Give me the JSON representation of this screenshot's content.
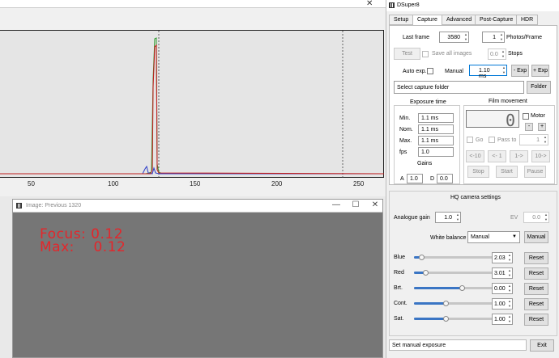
{
  "histogram": {
    "x_ticks": [
      "50",
      "100",
      "150",
      "200",
      "250"
    ],
    "close_glyph": "✕"
  },
  "image_window": {
    "title": "Image: Previous 1320",
    "overlay_focus": "Focus: 0.12",
    "overlay_max": "Max:    0.12",
    "minimize": "—",
    "maximize": "☐",
    "close": "✕"
  },
  "app": {
    "title": "DSuper8",
    "tabs": [
      "Setup",
      "Capture",
      "Advanced",
      "Post-Capture",
      "HDR"
    ],
    "active_tab": "Capture",
    "last_frame_label": "Last frame",
    "last_frame_value": "3580",
    "photos_value": "1",
    "photos_label": "Photos/Frame",
    "test_button": "Test",
    "save_all_label": "Save all images",
    "stops_value": "0.0",
    "stops_label": "Stops",
    "auto_exp_label": "Auto exp.",
    "manual_label": "Manual",
    "manual_value": "1.10 ms",
    "minus_exp": "- Exp",
    "plus_exp": "+ Exp",
    "capture_folder_placeholder": "Select capture folder",
    "folder_button": "Folder",
    "exposure_time": {
      "header": "Exposure time",
      "min_label": "Min.",
      "min_value": "1.1 ms",
      "nom_label": "Nom.",
      "nom_value": "1.1 ms",
      "max_label": "Max.",
      "max_value": "1.1 ms",
      "fps_label": "fps",
      "fps_value": "1.0"
    },
    "gains": {
      "header": "Gains",
      "a_label": "A",
      "a_value": "1.0",
      "d_label": "D",
      "d_value": "0.0"
    },
    "film_movement": {
      "header": "Film movement",
      "counter": "0",
      "motor_label": "Motor",
      "minus": "-",
      "plus": "+",
      "go_label": "Go",
      "pass_to_label": "Pass to",
      "pass_to_value": "1",
      "back10": "<-10",
      "back1": "<- 1",
      "fwd1": "1->",
      "fwd10": "10->",
      "stop": "Stop",
      "start": "Start",
      "pause": "Pause"
    },
    "hq": {
      "header": "HQ camera settings",
      "analogue_gain_label": "Analogue gain",
      "analogue_gain_value": "1.0",
      "ev_label": "EV",
      "ev_value": "0.0",
      "white_balance_label": "White balance",
      "white_balance_selected": "Manual",
      "white_balance_button": "Manual",
      "sliders": [
        {
          "label": "Blue",
          "value": "2.03",
          "reset": "Reset",
          "level": 0.08
        },
        {
          "label": "Red",
          "value": "3.01",
          "reset": "Reset",
          "level": 0.12
        },
        {
          "label": "Brt.",
          "value": "0.00",
          "reset": "Reset",
          "level": 0.5
        },
        {
          "label": "Cont.",
          "value": "1.00",
          "reset": "Reset",
          "level": 0.33
        },
        {
          "label": "Sat.",
          "value": "1.00",
          "reset": "Reset",
          "level": 0.33
        }
      ]
    },
    "status_text": "Set manual exposure",
    "exit_button": "Exit"
  }
}
